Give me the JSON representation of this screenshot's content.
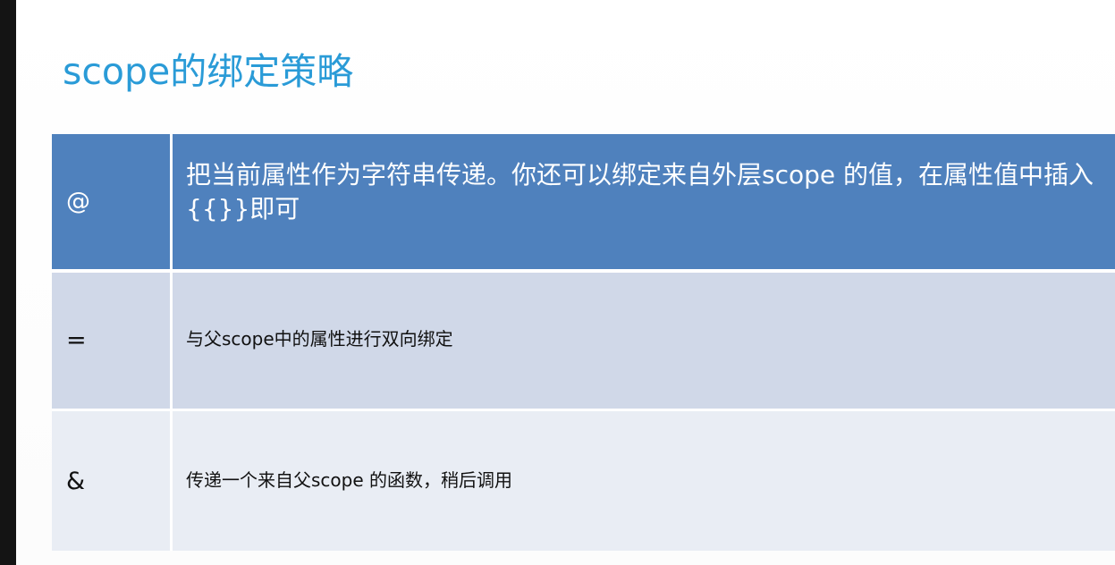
{
  "slide": {
    "title": "scope的绑定策略"
  },
  "table": {
    "rows": [
      {
        "symbol": "@",
        "description": "把当前属性作为字符串传递。你还可以绑定来自外层scope 的值，在属性值中插入{{}}即可"
      },
      {
        "symbol": "=",
        "description": "与父scope中的属性进行双向绑定"
      },
      {
        "symbol": "&",
        "description": "传递一个来自父scope 的函数，稍后调用"
      }
    ]
  },
  "colors": {
    "title": "#2a9bd7",
    "header_row": "#4f81bd",
    "row_band_1": "#d0d8e8",
    "row_band_2": "#e9edf4"
  }
}
